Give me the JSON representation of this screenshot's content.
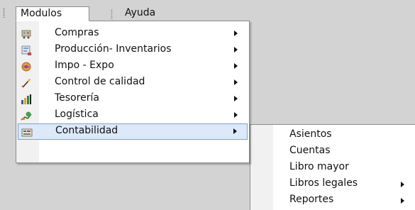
{
  "menubar": {
    "items": [
      {
        "label": "Modulos",
        "active": true
      },
      {
        "label": "Ayuda",
        "active": false
      }
    ]
  },
  "dropdown": {
    "items": [
      {
        "label": "Compras",
        "icon": "shopping-cart-icon",
        "has_submenu": true
      },
      {
        "label": "Producción- Inventarios",
        "icon": "factory-icon",
        "has_submenu": true
      },
      {
        "label": "Impo - Expo",
        "icon": "globe-icon",
        "has_submenu": true
      },
      {
        "label": "Control de calidad",
        "icon": "pen-check-icon",
        "has_submenu": true
      },
      {
        "label": "Tesorería",
        "icon": "bar-chart-icon",
        "has_submenu": true
      },
      {
        "label": "Logística",
        "icon": "logistics-icon",
        "has_submenu": true
      },
      {
        "label": "Contabilidad",
        "icon": "ledger-icon",
        "has_submenu": true,
        "highlighted": true
      }
    ]
  },
  "submenu": {
    "items": [
      {
        "label": "Asientos",
        "has_submenu": false
      },
      {
        "label": "Cuentas",
        "has_submenu": false
      },
      {
        "label": "Libro mayor",
        "has_submenu": false
      },
      {
        "label": "Libros legales",
        "has_submenu": true
      },
      {
        "label": "Reportes",
        "has_submenu": true
      }
    ]
  },
  "colors": {
    "background": "#d3d3d3",
    "menu_bg": "#ffffff",
    "icon_column": "#f1f1f1",
    "highlight_bg": "#dbe9f9",
    "highlight_border": "#6ea7de"
  }
}
